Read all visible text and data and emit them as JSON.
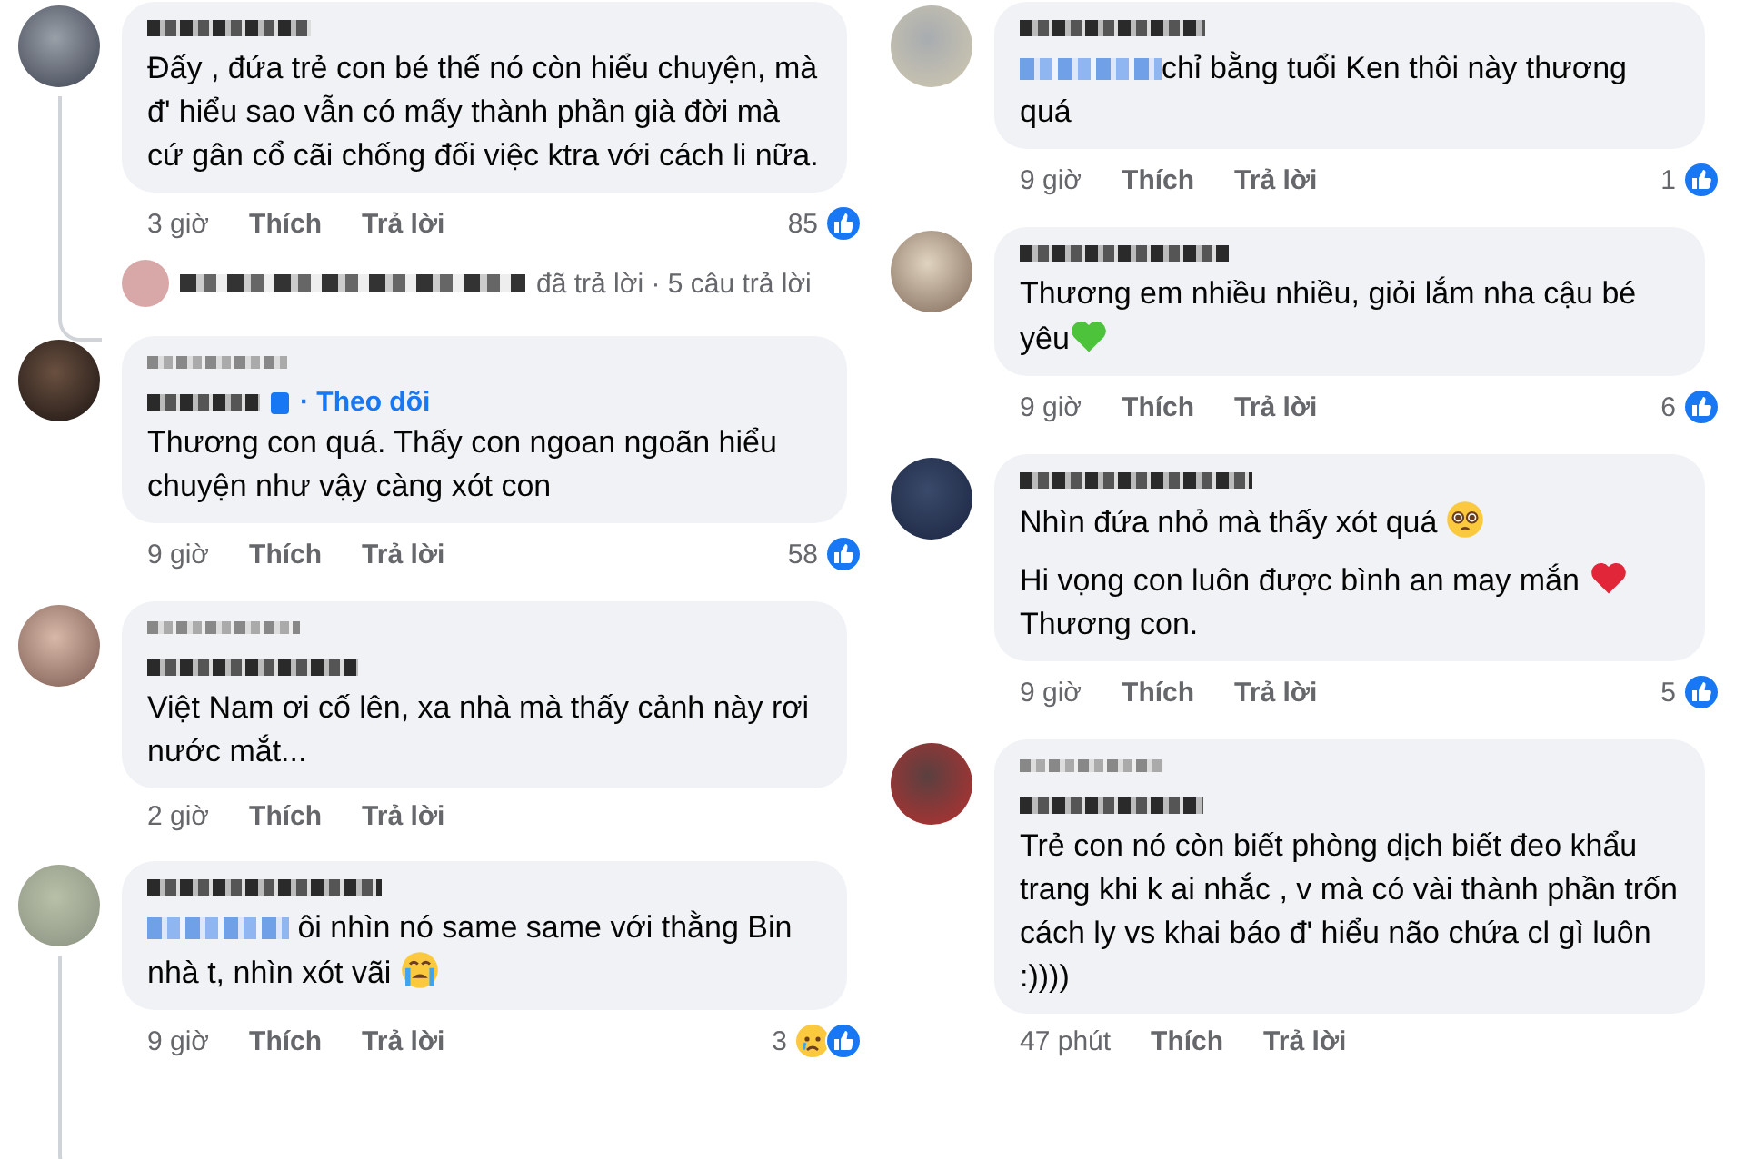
{
  "columns": [
    {
      "comments": [
        {
          "header": [
            {
              "kind": "blurred-name"
            }
          ],
          "thread_line": true,
          "body": [
            [
              {
                "kind": "text",
                "text": "Đấy , đứa trẻ con bé thế nó còn hiểu chuyện, mà đ' hiểu sao vẫn có mấy thành phần già đời mà cứ gân cổ cãi chống đối việc ktra với cách li nữa."
              }
            ]
          ],
          "time": "3 giờ",
          "like": "Thích",
          "reply": "Trả lời",
          "reaction_count": "85",
          "reactions": [
            {
              "kind": "like"
            }
          ],
          "replies": {
            "text": "đã trả lời · 5 câu trả lời"
          }
        },
        {
          "header": [
            {
              "kind": "blurred-label"
            },
            {
              "kind": "name-follow",
              "follow": "· Theo dõi"
            }
          ],
          "thread_line": false,
          "body": [
            [
              {
                "kind": "text",
                "text": "Thương con quá. Thấy con ngoan ngoãn hiểu chuyện như vậy càng xót con"
              }
            ]
          ],
          "time": "9 giờ",
          "like": "Thích",
          "reply": "Trả lời",
          "reaction_count": "58",
          "reactions": [
            {
              "kind": "like"
            }
          ]
        },
        {
          "header": [
            {
              "kind": "blurred-label"
            },
            {
              "kind": "blurred-name"
            }
          ],
          "thread_line": false,
          "body": [
            [
              {
                "kind": "text",
                "text": "Việt Nam ơi cố lên, xa nhà mà thấy cảnh này rơi nước mắt..."
              }
            ]
          ],
          "time": "2 giờ",
          "like": "Thích",
          "reply": "Trả lời"
        },
        {
          "header": [
            {
              "kind": "blurred-name"
            }
          ],
          "thread_line": true,
          "body": [
            [
              {
                "kind": "mention"
              },
              {
                "kind": "text",
                "text": " ôi nhìn nó same same với thằng Bin nhà t, nhìn xót vãi "
              },
              {
                "kind": "crying-emoji"
              }
            ]
          ],
          "time": "9 giờ",
          "like": "Thích",
          "reply": "Trả lời",
          "reaction_count": "3",
          "reactions": [
            {
              "kind": "sad"
            },
            {
              "kind": "like"
            }
          ]
        }
      ]
    },
    {
      "comments": [
        {
          "header": [
            {
              "kind": "blurred-name"
            }
          ],
          "thread_line": false,
          "body": [
            [
              {
                "kind": "mention"
              },
              {
                "kind": "text",
                "text": "chỉ bằng tuổi Ken thôi này thương quá"
              }
            ]
          ],
          "time": "9 giờ",
          "like": "Thích",
          "reply": "Trả lời",
          "reaction_count": "1",
          "reactions": [
            {
              "kind": "like"
            }
          ]
        },
        {
          "header": [
            {
              "kind": "blurred-name"
            }
          ],
          "thread_line": false,
          "body": [
            [
              {
                "kind": "text",
                "text": "Thương em nhiều nhiều, giỏi lắm nha cậu bé yêu"
              },
              {
                "kind": "heart-emoji",
                "color": "#4cc33a"
              }
            ]
          ],
          "time": "9 giờ",
          "like": "Thích",
          "reply": "Trả lời",
          "reaction_count": "6",
          "reactions": [
            {
              "kind": "like"
            }
          ]
        },
        {
          "header": [
            {
              "kind": "blurred-name"
            }
          ],
          "thread_line": false,
          "body": [
            [
              {
                "kind": "text",
                "text": "Nhìn đứa nhỏ mà thấy xót quá "
              },
              {
                "kind": "pleading-emoji"
              }
            ],
            [
              {
                "kind": "text",
                "text": "Hi vọng con luôn được bình an may mắn "
              },
              {
                "kind": "heart-emoji",
                "color": "#e2263a"
              },
              {
                "kind": "text",
                "text": " Thương con."
              }
            ]
          ],
          "time": "9 giờ",
          "like": "Thích",
          "reply": "Trả lời",
          "reaction_count": "5",
          "reactions": [
            {
              "kind": "like"
            }
          ]
        },
        {
          "header": [
            {
              "kind": "blurred-label"
            },
            {
              "kind": "blurred-name"
            }
          ],
          "thread_line": false,
          "body": [
            [
              {
                "kind": "text",
                "text": "Trẻ con nó còn biết phòng dịch biết đeo khẩu trang khi k ai nhắc , v mà có vài thành phần trốn cách ly vs khai báo đ' hiểu não chứa cl gì luôn :))))"
              }
            ]
          ],
          "time": "47 phút",
          "like": "Thích",
          "reply": "Trả lời"
        }
      ]
    }
  ]
}
